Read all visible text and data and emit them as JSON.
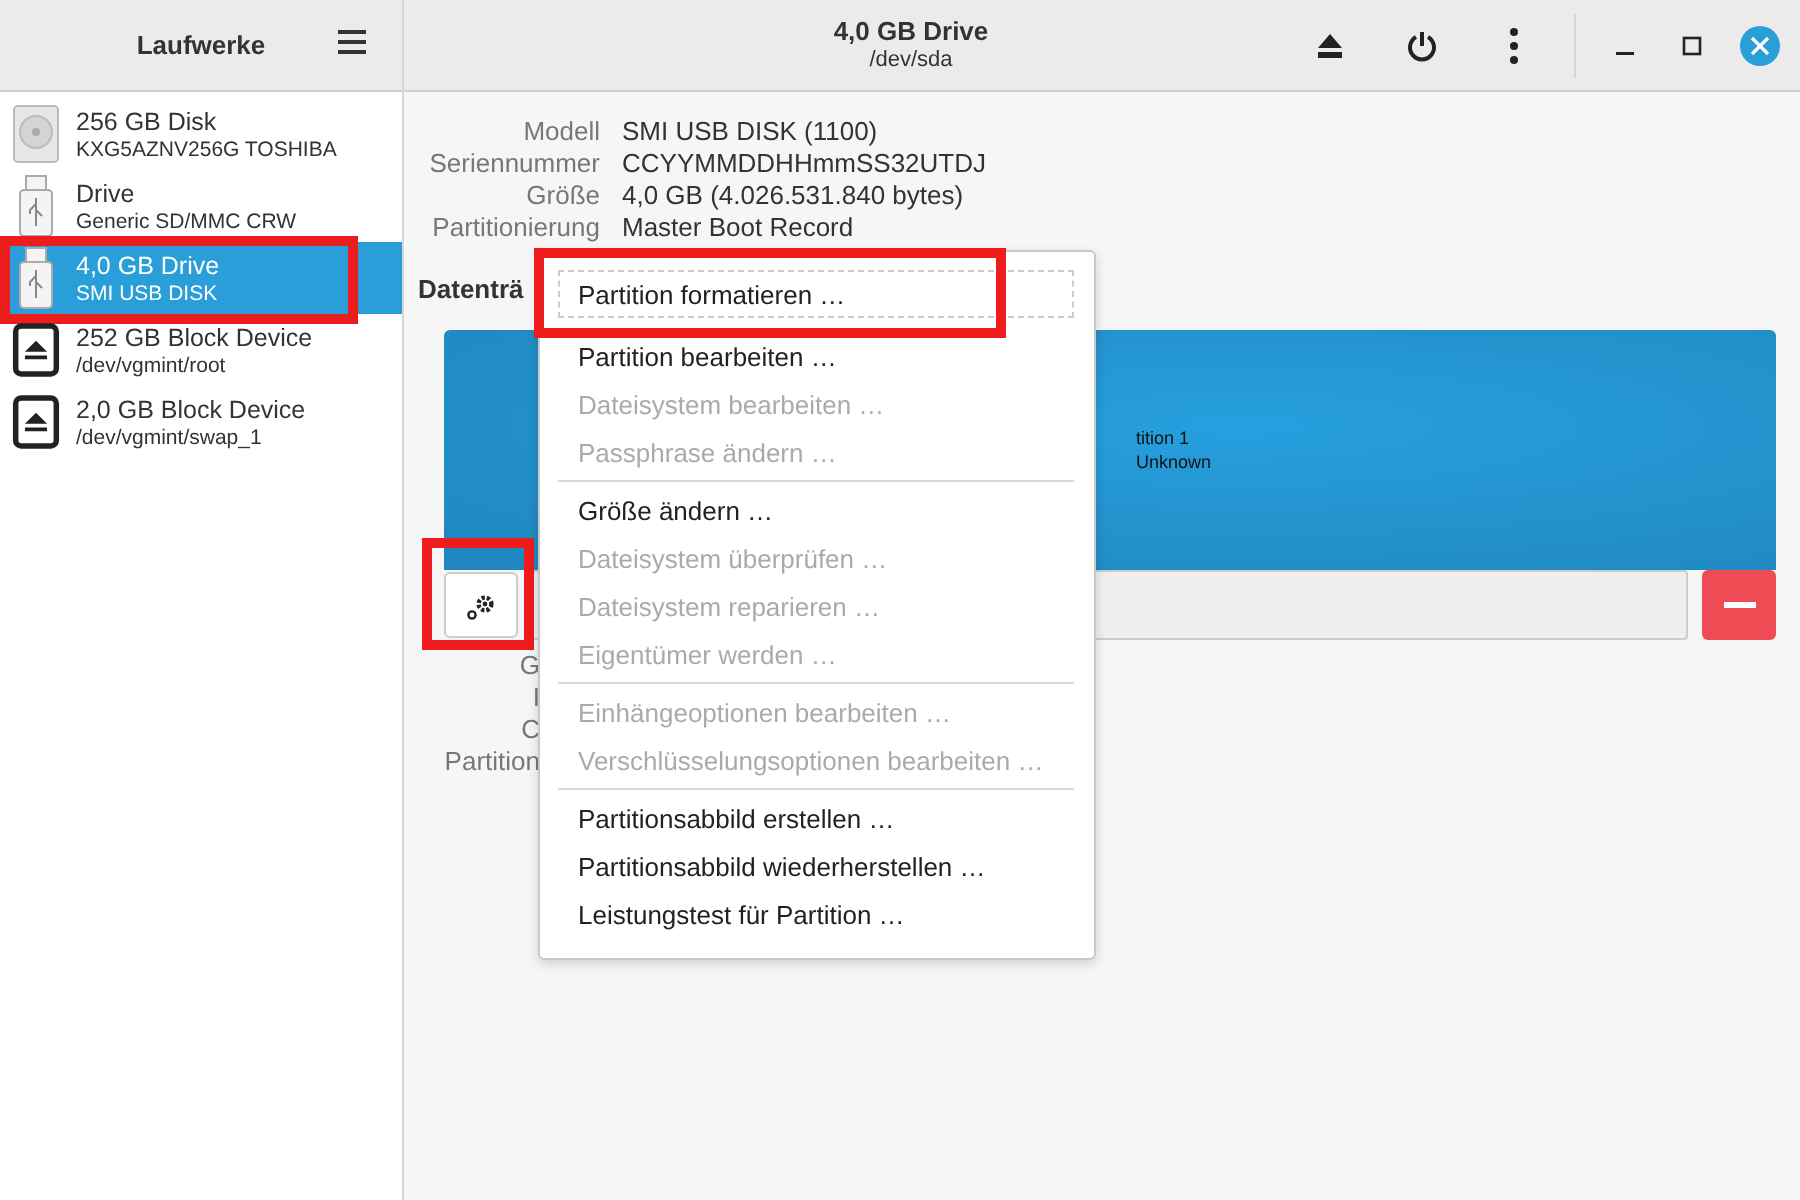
{
  "sidebar": {
    "title": "Laufwerke",
    "items": [
      {
        "kind": "hdd",
        "name": "256 GB Disk",
        "detail": "KXG5AZNV256G TOSHIBA",
        "selected": false,
        "highlighted": false
      },
      {
        "kind": "usb",
        "name": "Drive",
        "detail": "Generic SD/MMC CRW",
        "selected": false,
        "highlighted": false
      },
      {
        "kind": "usb",
        "name": "4,0 GB Drive",
        "detail": "SMI USB DISK",
        "selected": true,
        "highlighted": true
      },
      {
        "kind": "block",
        "name": "252 GB Block Device",
        "detail": "/dev/vgmint/root",
        "selected": false,
        "highlighted": false
      },
      {
        "kind": "block",
        "name": "2,0 GB Block Device",
        "detail": "/dev/vgmint/swap_1",
        "selected": false,
        "highlighted": false
      }
    ]
  },
  "header": {
    "title": "4,0 GB Drive",
    "subtitle": "/dev/sda"
  },
  "details": [
    {
      "label": "Modell",
      "value": "SMI USB DISK (1100)"
    },
    {
      "label": "Seriennummer",
      "value": "CCYYMMDDHHmmSS32UTDJ"
    },
    {
      "label": "Größe",
      "value": "4,0 GB (4.026.531.840 bytes)"
    },
    {
      "label": "Partitionierung",
      "value": "Master Boot Record"
    }
  ],
  "volumes": {
    "heading": "Datenträ",
    "partition_lines": [
      "tition 1",
      "Unknown"
    ],
    "gear_highlighted": true,
    "labels": [
      "G",
      "I",
      "C",
      "Partition"
    ]
  },
  "menu": {
    "items": [
      {
        "kind": "item",
        "label": "Partition formatieren …",
        "disabled": false,
        "focused": true,
        "highlighted": true
      },
      {
        "kind": "item",
        "label": "Partition bearbeiten …",
        "disabled": false,
        "focused": false,
        "highlighted": false
      },
      {
        "kind": "item",
        "label": "Dateisystem bearbeiten …",
        "disabled": true,
        "focused": false,
        "highlighted": false
      },
      {
        "kind": "item",
        "label": "Passphrase ändern …",
        "disabled": true,
        "focused": false,
        "highlighted": false
      },
      {
        "kind": "separator"
      },
      {
        "kind": "item",
        "label": "Größe ändern …",
        "disabled": false,
        "focused": false,
        "highlighted": false
      },
      {
        "kind": "item",
        "label": "Dateisystem überprüfen …",
        "disabled": true,
        "focused": false,
        "highlighted": false
      },
      {
        "kind": "item",
        "label": "Dateisystem reparieren …",
        "disabled": true,
        "focused": false,
        "highlighted": false
      },
      {
        "kind": "item",
        "label": "Eigentümer werden …",
        "disabled": true,
        "focused": false,
        "highlighted": false
      },
      {
        "kind": "separator"
      },
      {
        "kind": "item",
        "label": "Einhängeoptionen bearbeiten …",
        "disabled": true,
        "focused": false,
        "highlighted": false
      },
      {
        "kind": "item",
        "label": "Verschlüsselungsoptionen bearbeiten …",
        "disabled": true,
        "focused": false,
        "highlighted": false
      },
      {
        "kind": "separator"
      },
      {
        "kind": "item",
        "label": "Partitionsabbild erstellen …",
        "disabled": false,
        "focused": false,
        "highlighted": false
      },
      {
        "kind": "item",
        "label": "Partitionsabbild wiederherstellen …",
        "disabled": false,
        "focused": false,
        "highlighted": false
      },
      {
        "kind": "item",
        "label": "Leistungstest für Partition …",
        "disabled": false,
        "focused": false,
        "highlighted": false
      }
    ]
  }
}
